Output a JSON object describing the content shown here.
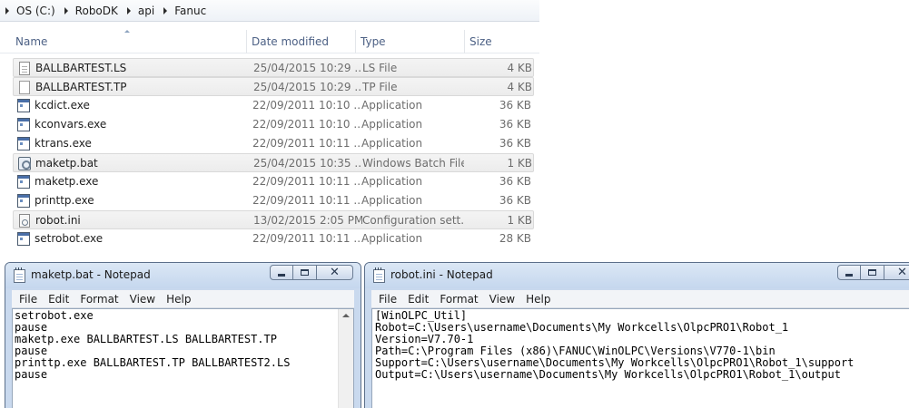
{
  "explorer": {
    "breadcrumbs": [
      "OS (C:)",
      "RoboDK",
      "api",
      "Fanuc"
    ],
    "columns": {
      "name": "Name",
      "date": "Date modified",
      "type": "Type",
      "size": "Size"
    },
    "files": [
      {
        "name": "BALLBARTEST.LS",
        "date": "25/04/2015 10:29 ...",
        "type": "LS File",
        "size": "4 KB",
        "icon": "text-file-icon",
        "selected": true
      },
      {
        "name": "BALLBARTEST.TP",
        "date": "25/04/2015 10:29 ...",
        "type": "TP File",
        "size": "4 KB",
        "icon": "blank-file-icon",
        "selected": true
      },
      {
        "name": "kcdict.exe",
        "date": "22/09/2011 10:10 ...",
        "type": "Application",
        "size": "36 KB",
        "icon": "application-icon",
        "selected": false
      },
      {
        "name": "kconvars.exe",
        "date": "22/09/2011 10:10 ...",
        "type": "Application",
        "size": "36 KB",
        "icon": "application-icon",
        "selected": false
      },
      {
        "name": "ktrans.exe",
        "date": "22/09/2011 10:11 ...",
        "type": "Application",
        "size": "36 KB",
        "icon": "application-icon",
        "selected": false
      },
      {
        "name": "maketp.bat",
        "date": "25/04/2015 10:35 ...",
        "type": "Windows Batch File",
        "size": "1 KB",
        "icon": "batch-file-icon",
        "selected": true
      },
      {
        "name": "maketp.exe",
        "date": "22/09/2011 10:11 ...",
        "type": "Application",
        "size": "36 KB",
        "icon": "application-icon",
        "selected": false
      },
      {
        "name": "printtp.exe",
        "date": "22/09/2011 10:11 ...",
        "type": "Application",
        "size": "36 KB",
        "icon": "application-icon",
        "selected": false
      },
      {
        "name": "robot.ini",
        "date": "13/02/2015 2:05 PM",
        "type": "Configuration sett...",
        "size": "1 KB",
        "icon": "settings-file-icon",
        "selected": true
      },
      {
        "name": "setrobot.exe",
        "date": "22/09/2011 10:11 ...",
        "type": "Application",
        "size": "28 KB",
        "icon": "application-icon",
        "selected": false
      }
    ]
  },
  "notepad1": {
    "title": "maketp.bat - Notepad",
    "menu": [
      "File",
      "Edit",
      "Format",
      "View",
      "Help"
    ],
    "content": "setrobot.exe\npause\nmaketp.exe BALLBARTEST.LS BALLBARTEST.TP\npause\nprinttp.exe BALLBARTEST.TP BALLBARTEST2.LS\npause"
  },
  "notepad2": {
    "title": "robot.ini - Notepad",
    "menu": [
      "File",
      "Edit",
      "Format",
      "View",
      "Help"
    ],
    "content": "[WinOLPC_Util]\nRobot=C:\\Users\\username\\Documents\\My Workcells\\OlpcPRO1\\Robot_1\nVersion=V7.70-1\nPath=C:\\Program Files (x86)\\FANUC\\WinOLPC\\Versions\\V770-1\\bin\nSupport=C:\\Users\\username\\Documents\\My Workcells\\OlpcPRO1\\Robot_1\\support\nOutput=C:\\Users\\username\\Documents\\My Workcells\\OlpcPRO1\\Robot_1\\output"
  }
}
